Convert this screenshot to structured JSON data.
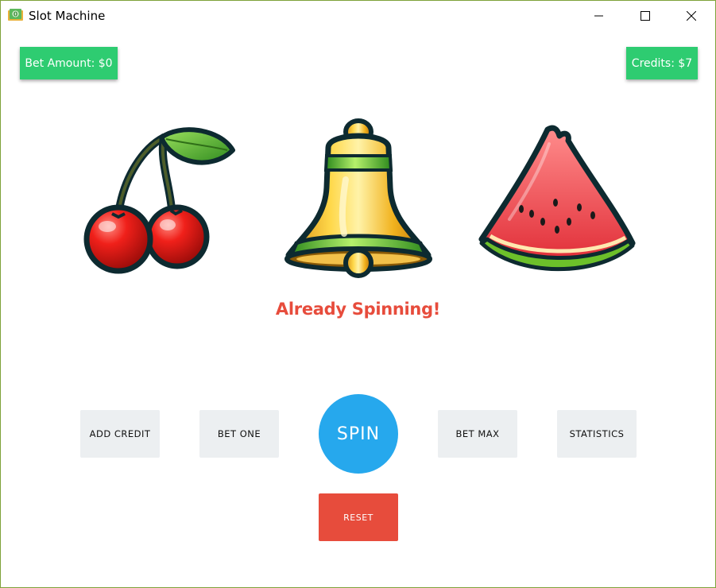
{
  "window": {
    "title": "Slot Machine",
    "app_icon": "money-icon",
    "controls": [
      "minimize-icon",
      "maximize-icon",
      "close-icon"
    ]
  },
  "header": {
    "bet_amount_label": "Bet Amount: $0",
    "credits_label": "Credits: $7"
  },
  "reels": [
    {
      "symbol": "cherry"
    },
    {
      "symbol": "bell"
    },
    {
      "symbol": "watermelon"
    }
  ],
  "status_message": "Already Spinning!",
  "buttons": {
    "add_credit": "ADD CREDIT",
    "bet_one": "BET ONE",
    "spin": "SPIN",
    "bet_max": "BET MAX",
    "statistics": "STATISTICS",
    "reset": "RESET"
  },
  "colors": {
    "chip_green": "#2ecc71",
    "spin_blue": "#26a8ed",
    "reset_red": "#e74c3c",
    "message_red": "#e74c3c",
    "button_gray": "#eceff1",
    "window_border": "#7ea23a"
  }
}
